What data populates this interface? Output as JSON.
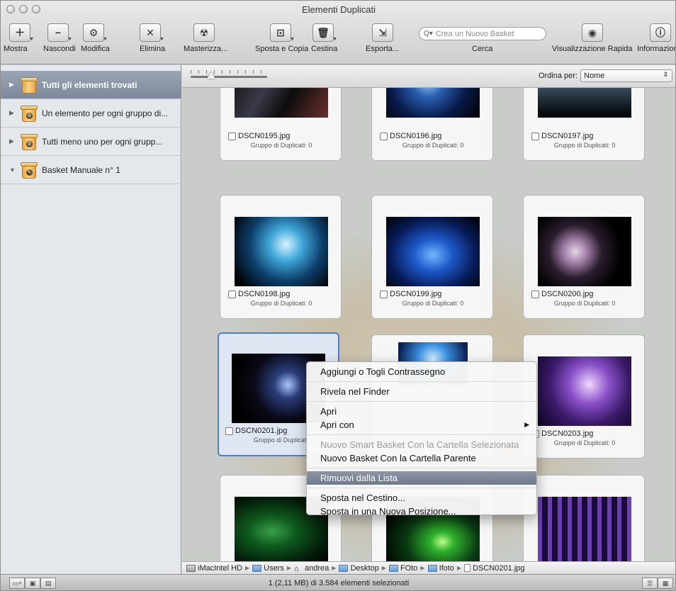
{
  "window": {
    "title": "Elementi Duplicati"
  },
  "toolbar": {
    "mostra": "Mostra",
    "nascondi": "Nascondi",
    "modifica": "Modifica",
    "elimina": "Elimina",
    "masterizza": "Masterizza...",
    "sposta_copia": "Sposta e Copia",
    "cestina": "Cestina",
    "esporta": "Esporta...",
    "search_placeholder": "Crea un Nuovo Basket",
    "cerca": "Cerca",
    "visualizzazione": "Visualizzazione Rapida",
    "informazioni": "Informazioni"
  },
  "sidebar": {
    "items": [
      {
        "label": "Tutti gli elementi trovati"
      },
      {
        "label": "Un elemento per ogni gruppo di..."
      },
      {
        "label": "Tutti meno uno per ogni grupp..."
      },
      {
        "label": "Basket Manuale n° 1"
      }
    ]
  },
  "content": {
    "sort_label": "Ordina per:",
    "sort_value": "Nome"
  },
  "tiles": [
    {
      "name": "DSCN0195.jpg",
      "group": "Gruppo di Duplicati: 0"
    },
    {
      "name": "DSCN0196.jpg",
      "group": "Gruppo di Duplicati: 0"
    },
    {
      "name": "DSCN0197.jpg",
      "group": "Gruppo di Duplicati: 0"
    },
    {
      "name": "DSCN0198.jpg",
      "group": "Gruppo di Duplicati: 0"
    },
    {
      "name": "DSCN0199.jpg",
      "group": "Gruppo di Duplicati: 0"
    },
    {
      "name": "DSCN0200.jpg",
      "group": "Gruppo di Duplicati: 0"
    },
    {
      "name": "DSCN0201.jpg",
      "group": "Gruppo di Duplicat"
    },
    {
      "name": "",
      "group": ""
    },
    {
      "name": "DSCN0203.jpg",
      "group": "Gruppo di Duplicati: 0"
    }
  ],
  "context_menu": {
    "items": [
      "Aggiungi o Togli Contrassegno",
      "Rivela nel Finder",
      "Apri",
      "Apri con",
      "Nuovo Smart Basket Con la Cartella Selezionata",
      "Nuovo Basket Con la Cartella Parente",
      "Rimuovi dalla Lista",
      "Sposta nel Cestino...",
      "Sposta in una Nuova Posizione..."
    ]
  },
  "pathbar": {
    "crumbs": [
      "iMacIntel HD",
      "Users",
      "andrea",
      "Desktop",
      "FOto",
      "Ifoto",
      "DSCN0201.jpg"
    ]
  },
  "status": {
    "text": "1 (2,11 MB) di 3.584 elementi selezionati"
  }
}
